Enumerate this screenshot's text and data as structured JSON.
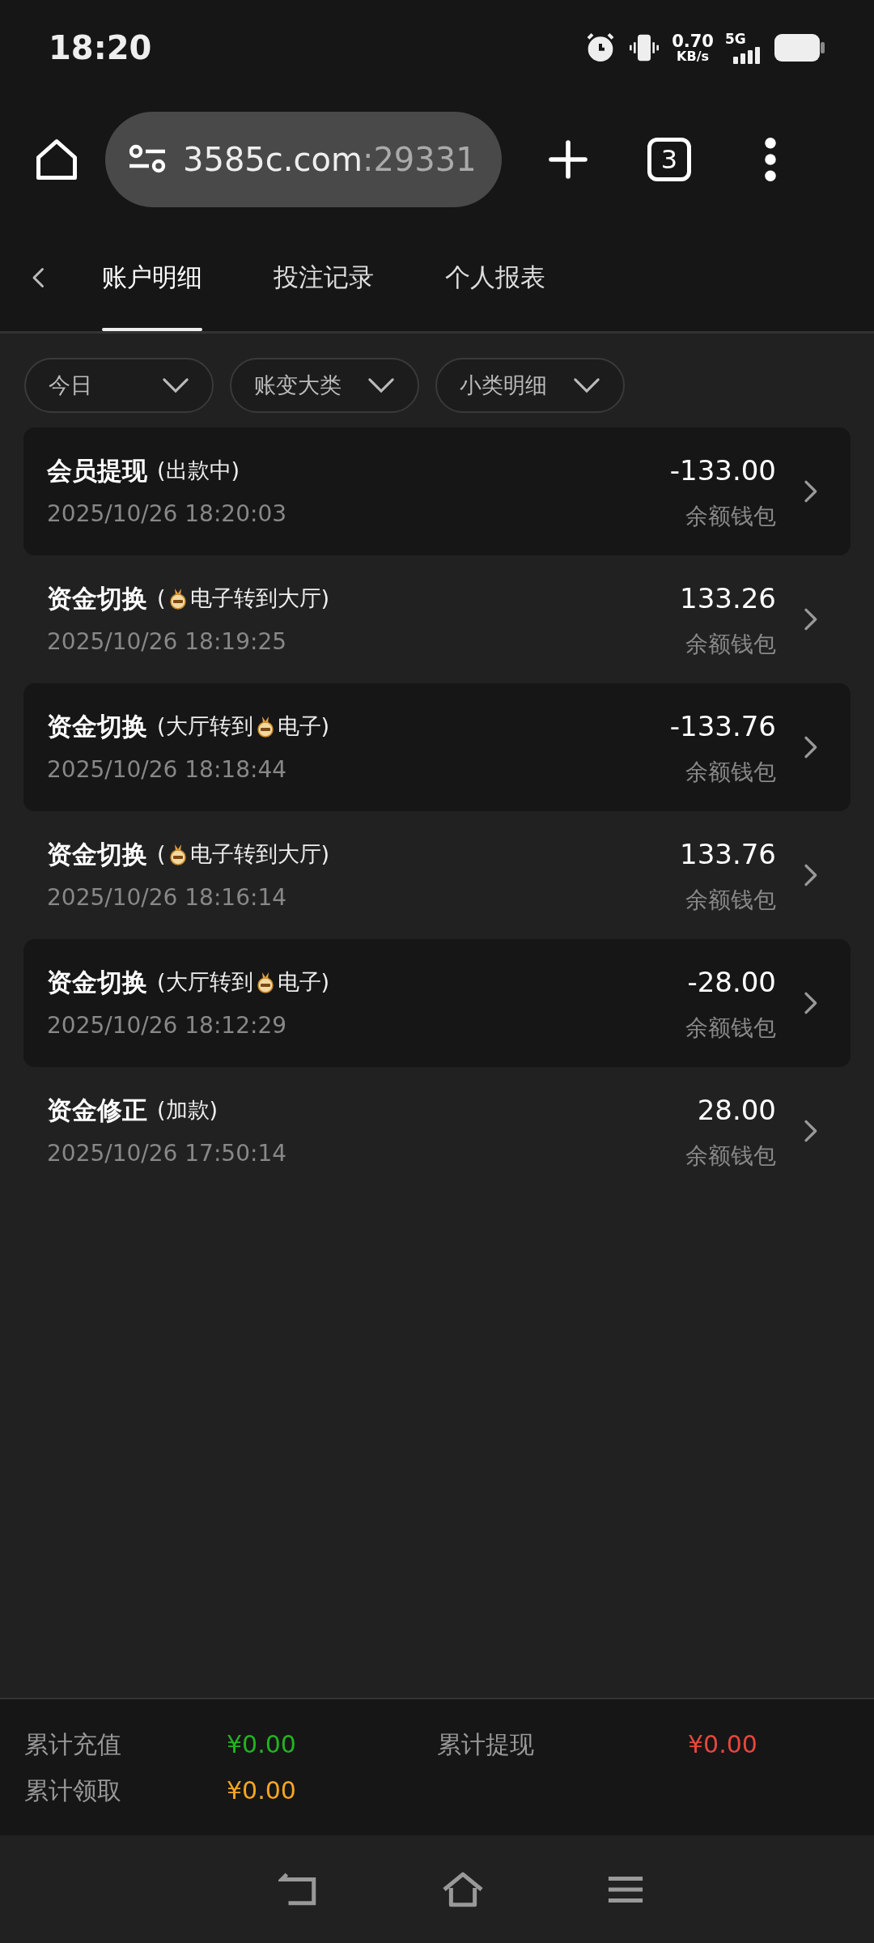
{
  "status_bar": {
    "time": "18:20",
    "speed_value": "0.70",
    "speed_unit": "KB/s",
    "network": "5G"
  },
  "browser": {
    "url_host": "3585c.com",
    "url_port": ":29331",
    "tab_count": "3"
  },
  "tabs": [
    {
      "label": "账户明细",
      "selected": true
    },
    {
      "label": "投注记录",
      "selected": false
    },
    {
      "label": "个人报表",
      "selected": false
    }
  ],
  "filters": [
    {
      "label": "今日"
    },
    {
      "label": "账变大类"
    },
    {
      "label": "小类明细"
    }
  ],
  "records": [
    {
      "title": "会员提现",
      "detail": [
        {
          "kind": "text",
          "text": "(出款中)"
        }
      ],
      "time": "2025/10/26 18:20:03",
      "amount": "-133.00",
      "wallet": "余额钱包"
    },
    {
      "title": "资金切换",
      "detail": [
        {
          "kind": "text",
          "text": "("
        },
        {
          "kind": "icon"
        },
        {
          "kind": "text",
          "text": "电子转到大厅)"
        }
      ],
      "time": "2025/10/26 18:19:25",
      "amount": "133.26",
      "wallet": "余额钱包"
    },
    {
      "title": "资金切换",
      "detail": [
        {
          "kind": "text",
          "text": "(大厅转到"
        },
        {
          "kind": "icon"
        },
        {
          "kind": "text",
          "text": "电子)"
        }
      ],
      "time": "2025/10/26 18:18:44",
      "amount": "-133.76",
      "wallet": "余额钱包"
    },
    {
      "title": "资金切换",
      "detail": [
        {
          "kind": "text",
          "text": "("
        },
        {
          "kind": "icon"
        },
        {
          "kind": "text",
          "text": "电子转到大厅)"
        }
      ],
      "time": "2025/10/26 18:16:14",
      "amount": "133.76",
      "wallet": "余额钱包"
    },
    {
      "title": "资金切换",
      "detail": [
        {
          "kind": "text",
          "text": "(大厅转到"
        },
        {
          "kind": "icon"
        },
        {
          "kind": "text",
          "text": "电子)"
        }
      ],
      "time": "2025/10/26 18:12:29",
      "amount": "-28.00",
      "wallet": "余额钱包"
    },
    {
      "title": "资金修正",
      "detail": [
        {
          "kind": "text",
          "text": "(加款)"
        }
      ],
      "time": "2025/10/26 17:50:14",
      "amount": "28.00",
      "wallet": "余额钱包"
    }
  ],
  "summary": [
    {
      "label": "累计充值",
      "value": "¥0.00",
      "color": "#22b322"
    },
    {
      "label": "累计提现",
      "value": "¥0.00",
      "color": "#e8463c"
    },
    {
      "label": "累计领取",
      "value": "¥0.00",
      "color": "#f5a623"
    }
  ]
}
